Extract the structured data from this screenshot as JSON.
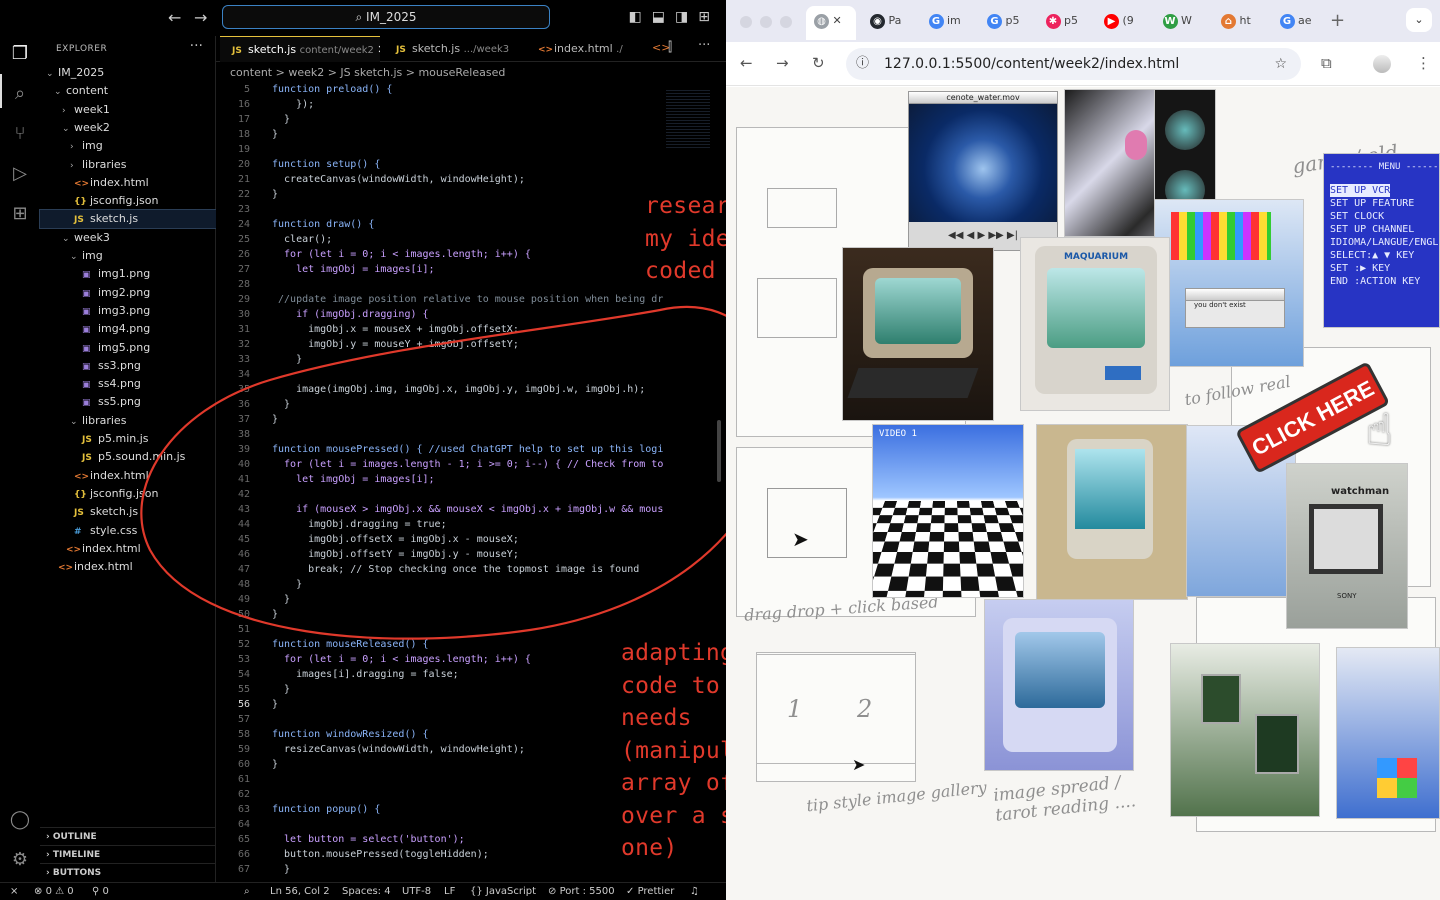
{
  "vscode": {
    "command_center": "IM_2025",
    "explorer": {
      "title": "EXPLORER",
      "tree": [
        {
          "label": "IM_2025",
          "depth": 0,
          "kind": "folder-open"
        },
        {
          "label": "content",
          "depth": 1,
          "kind": "folder-open"
        },
        {
          "label": "week1",
          "depth": 2,
          "kind": "folder"
        },
        {
          "label": "week2",
          "depth": 2,
          "kind": "folder-open"
        },
        {
          "label": "img",
          "depth": 3,
          "kind": "folder"
        },
        {
          "label": "libraries",
          "depth": 3,
          "kind": "folder"
        },
        {
          "label": "index.html",
          "depth": 3,
          "kind": "html"
        },
        {
          "label": "jsconfig.json",
          "depth": 3,
          "kind": "json"
        },
        {
          "label": "sketch.js",
          "depth": 3,
          "kind": "js",
          "selected": true
        },
        {
          "label": "week3",
          "depth": 2,
          "kind": "folder-open"
        },
        {
          "label": "img",
          "depth": 3,
          "kind": "folder-open"
        },
        {
          "label": "img1.png",
          "depth": 4,
          "kind": "img"
        },
        {
          "label": "img2.png",
          "depth": 4,
          "kind": "img"
        },
        {
          "label": "img3.png",
          "depth": 4,
          "kind": "img"
        },
        {
          "label": "img4.png",
          "depth": 4,
          "kind": "img"
        },
        {
          "label": "img5.png",
          "depth": 4,
          "kind": "img"
        },
        {
          "label": "ss3.png",
          "depth": 4,
          "kind": "img"
        },
        {
          "label": "ss4.png",
          "depth": 4,
          "kind": "img"
        },
        {
          "label": "ss5.png",
          "depth": 4,
          "kind": "img"
        },
        {
          "label": "libraries",
          "depth": 3,
          "kind": "folder-open"
        },
        {
          "label": "p5.min.js",
          "depth": 4,
          "kind": "js"
        },
        {
          "label": "p5.sound.min.js",
          "depth": 4,
          "kind": "js"
        },
        {
          "label": "index.html",
          "depth": 3,
          "kind": "html"
        },
        {
          "label": "jsconfig.json",
          "depth": 3,
          "kind": "json"
        },
        {
          "label": "sketch.js",
          "depth": 3,
          "kind": "js"
        },
        {
          "label": "style.css",
          "depth": 3,
          "kind": "css"
        },
        {
          "label": "index.html",
          "depth": 2,
          "kind": "html"
        },
        {
          "label": "index.html",
          "depth": 1,
          "kind": "html"
        }
      ],
      "panels": [
        "OUTLINE",
        "TIMELINE",
        "BUTTONS"
      ]
    },
    "tabs": [
      {
        "label": "sketch.js",
        "desc": "content/week2",
        "icon": "JS",
        "active": true
      },
      {
        "label": "sketch.js",
        "desc": ".../week3",
        "icon": "JS",
        "active": false
      },
      {
        "label": "index.html",
        "desc": "./",
        "icon": "<>",
        "active": false
      }
    ],
    "breadcrumb": "content  >  week2  >  JS sketch.js  >  mouseReleased",
    "code": [
      {
        "n": "5",
        "t": "function preload() {"
      },
      {
        "n": "16",
        "t": "    });"
      },
      {
        "n": "17",
        "t": "  }"
      },
      {
        "n": "18",
        "t": "}"
      },
      {
        "n": "19",
        "t": ""
      },
      {
        "n": "20",
        "t": "function setup() {"
      },
      {
        "n": "21",
        "t": "  createCanvas(windowWidth, windowHeight);"
      },
      {
        "n": "22",
        "t": "}"
      },
      {
        "n": "23",
        "t": ""
      },
      {
        "n": "24",
        "t": "function draw() {"
      },
      {
        "n": "25",
        "t": "  clear();"
      },
      {
        "n": "26",
        "t": "  for (let i = 0; i < images.length; i++) {"
      },
      {
        "n": "27",
        "t": "    let imgObj = images[i];"
      },
      {
        "n": "28",
        "t": ""
      },
      {
        "n": "29",
        "t": " //update image position relative to mouse position when being dr"
      },
      {
        "n": "30",
        "t": "    if (imgObj.dragging) {"
      },
      {
        "n": "31",
        "t": "      imgObj.x = mouseX + imgObj.offsetX;"
      },
      {
        "n": "32",
        "t": "      imgObj.y = mouseY + imgObj.offsetY;"
      },
      {
        "n": "33",
        "t": "    }"
      },
      {
        "n": "34",
        "t": ""
      },
      {
        "n": "35",
        "t": "    image(imgObj.img, imgObj.x, imgObj.y, imgObj.w, imgObj.h);"
      },
      {
        "n": "36",
        "t": "  }"
      },
      {
        "n": "37",
        "t": "}"
      },
      {
        "n": "38",
        "t": ""
      },
      {
        "n": "39",
        "t": "function mousePressed() { //used ChatGPT help to set up this logi"
      },
      {
        "n": "40",
        "t": "  for (let i = images.length - 1; i >= 0; i--) { // Check from to"
      },
      {
        "n": "41",
        "t": "    let imgObj = images[i];"
      },
      {
        "n": "42",
        "t": ""
      },
      {
        "n": "43",
        "t": "    if (mouseX > imgObj.x && mouseX < imgObj.x + imgObj.w && mous"
      },
      {
        "n": "44",
        "t": "      imgObj.dragging = true;"
      },
      {
        "n": "45",
        "t": "      imgObj.offsetX = imgObj.x - mouseX;"
      },
      {
        "n": "46",
        "t": "      imgObj.offsetY = imgObj.y - mouseY;"
      },
      {
        "n": "47",
        "t": "      break; // Stop checking once the topmost image is found"
      },
      {
        "n": "48",
        "t": "    }"
      },
      {
        "n": "49",
        "t": "  }"
      },
      {
        "n": "50",
        "t": "}"
      },
      {
        "n": "51",
        "t": ""
      },
      {
        "n": "52",
        "t": "function mouseReleased() {"
      },
      {
        "n": "53",
        "t": "  for (let i = 0; i < images.length; i++) {"
      },
      {
        "n": "54",
        "t": "    images[i].dragging = false;"
      },
      {
        "n": "55",
        "t": "  }"
      },
      {
        "n": "56",
        "t": "}"
      },
      {
        "n": "57",
        "t": ""
      },
      {
        "n": "58",
        "t": "function windowResized() {"
      },
      {
        "n": "59",
        "t": "  resizeCanvas(windowWidth, windowHeight);"
      },
      {
        "n": "60",
        "t": "}"
      },
      {
        "n": "61",
        "t": ""
      },
      {
        "n": "62",
        "t": ""
      },
      {
        "n": "63",
        "t": "function popup() {"
      },
      {
        "n": "64",
        "t": ""
      },
      {
        "n": "65",
        "t": "  let button = select('button');"
      },
      {
        "n": "66",
        "t": "  button.mousePressed(toggleHidden);"
      },
      {
        "n": "67",
        "t": "  }"
      }
    ],
    "current_line": "56",
    "status": {
      "errors": "0",
      "warnings": "0",
      "ports": "0",
      "position": "Ln 56, Col 2",
      "spaces": "Spaces: 4",
      "encoding": "UTF-8",
      "eol": "LF",
      "language": "JavaScript",
      "port": "Port : 5500",
      "formatter": "Prettier"
    }
  },
  "annotations": {
    "top_note": "researching how to\nmy ideas can be\ncoded",
    "bottom_note": "adapting source\ncode to suit my\nneeds\n(manipulate an\narray of image\nover a singular\none)"
  },
  "browser": {
    "tabs": [
      {
        "icon": "globe-icon",
        "label": "",
        "active": true
      },
      {
        "icon": "github-icon",
        "label": "Pa"
      },
      {
        "icon": "google-icon",
        "label": "im"
      },
      {
        "icon": "google-icon",
        "label": "p5"
      },
      {
        "icon": "p5-icon",
        "label": "p5"
      },
      {
        "icon": "youtube-icon",
        "label": "(9"
      },
      {
        "icon": "w-icon",
        "label": "W"
      },
      {
        "icon": "html-icon",
        "label": "ht"
      },
      {
        "icon": "google-icon",
        "label": "ae"
      }
    ],
    "url": "127.0.0.1:5500/content/week2/index.html"
  },
  "page": {
    "video_window_title": "cenote_water.mov",
    "aquarium_brand": "MAQUARIUM",
    "menu_title": "-------- MENU --------",
    "menu_items": [
      "SET UP VCR",
      "SET UP FEATURE",
      "SET CLOCK",
      "SET UP CHANNEL",
      "IDIOMA/LANGUE/ENGL",
      "SELECT:▲ ▼ KEY",
      "SET     :▶ KEY",
      "END     :ACTION KEY"
    ],
    "click_here": "CLICK HERE",
    "video_label": "VIDEO 1",
    "tv_brand": "watchman",
    "tv_maker": "SONY",
    "sketch_notes": [
      {
        "text": "game / old",
        "kind": "note"
      },
      {
        "text": "drag drop + click based",
        "kind": "note"
      },
      {
        "text": "image spread / tarot reading ....",
        "kind": "note"
      },
      {
        "text": "tip style image gallery",
        "kind": "note"
      },
      {
        "text": "to follow real",
        "kind": "note"
      },
      {
        "text": "1",
        "kind": "note"
      },
      {
        "text": "2",
        "kind": "note"
      }
    ],
    "dialog_text": "you don't exist"
  },
  "colors": {
    "accent": "#3b82c4",
    "annotation": "#e0392b",
    "js_icon": "#e5c13c",
    "html_icon": "#e37933"
  }
}
